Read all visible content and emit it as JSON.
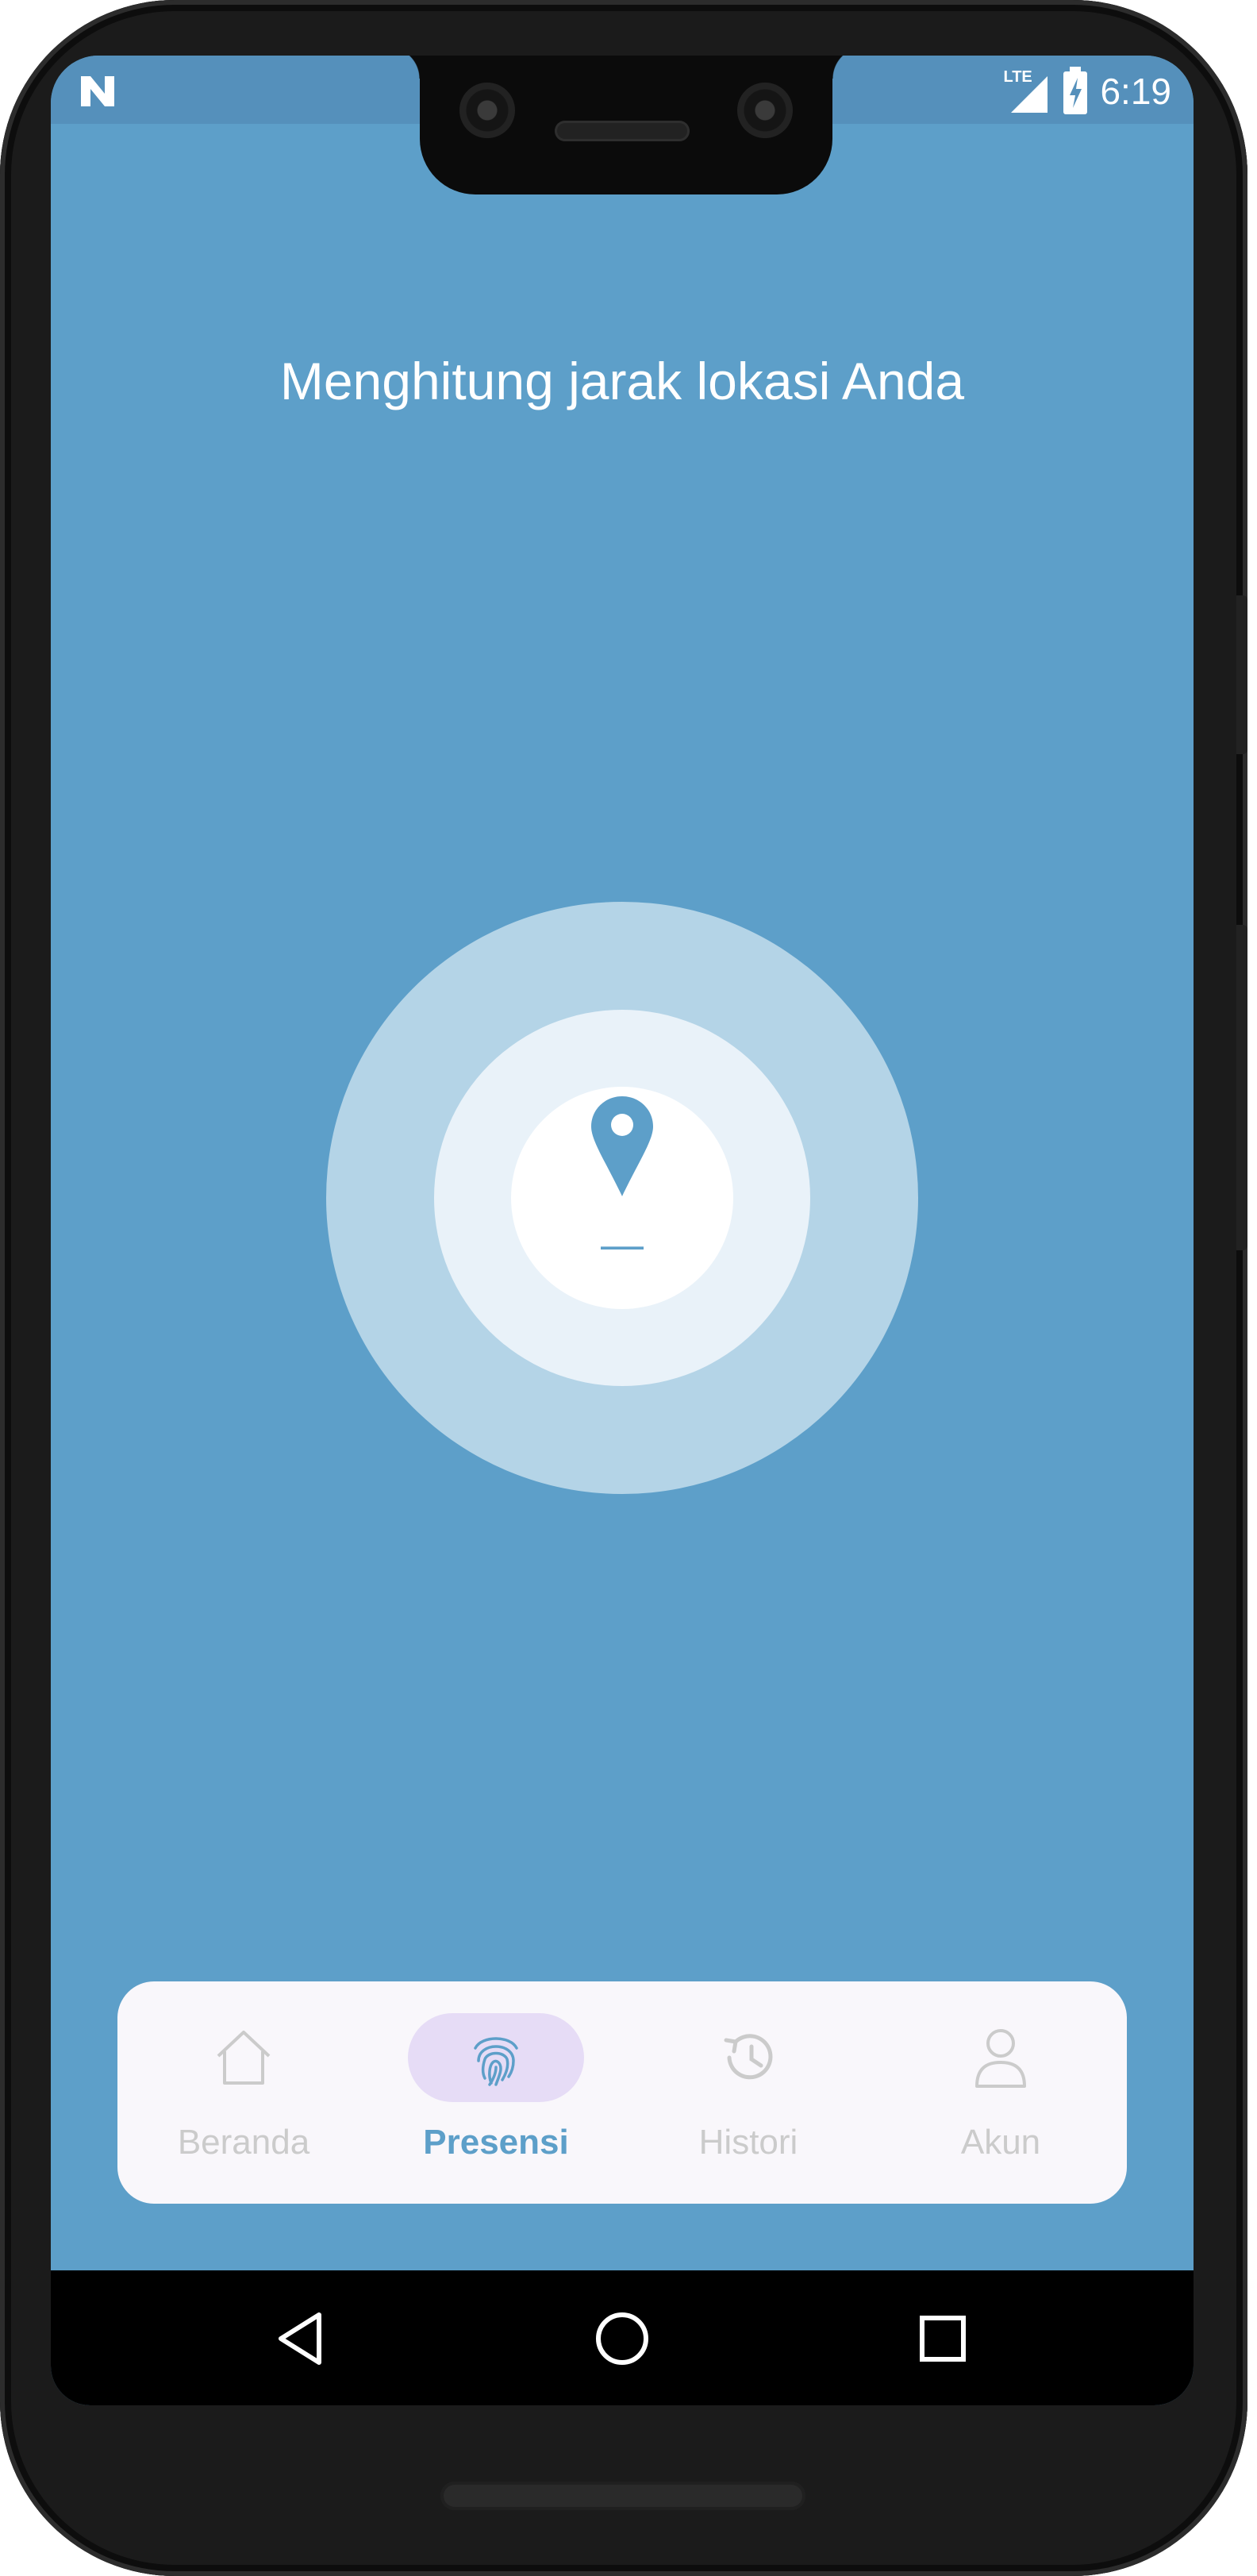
{
  "status_bar": {
    "time": "6:19",
    "network": "LTE",
    "left_icon": "n-logo-icon",
    "signal_icon": "signal-icon",
    "battery_icon": "battery-charging-icon"
  },
  "main": {
    "headline": "Menghitung jarak lokasi Anda",
    "distance_value": "—",
    "pin_icon": "location-pin-icon"
  },
  "bottom_nav": {
    "items": [
      {
        "label": "Beranda",
        "icon": "home-icon",
        "active": false
      },
      {
        "label": "Presensi",
        "icon": "fingerprint-icon",
        "active": true
      },
      {
        "label": "Histori",
        "icon": "history-icon",
        "active": false
      },
      {
        "label": "Akun",
        "icon": "user-icon",
        "active": false
      }
    ]
  },
  "android_nav": {
    "buttons": [
      "back-icon",
      "home-circle-icon",
      "recents-icon"
    ]
  },
  "colors": {
    "background": "#5d9fc9",
    "status_bar": "#5590bb",
    "ring_outer": "#b4d4e7",
    "ring_middle": "#e9f2f9",
    "accent": "#5d9fc9",
    "nav_active_pill": "#e6dcf6",
    "nav_inactive": "#cbcbcb"
  }
}
